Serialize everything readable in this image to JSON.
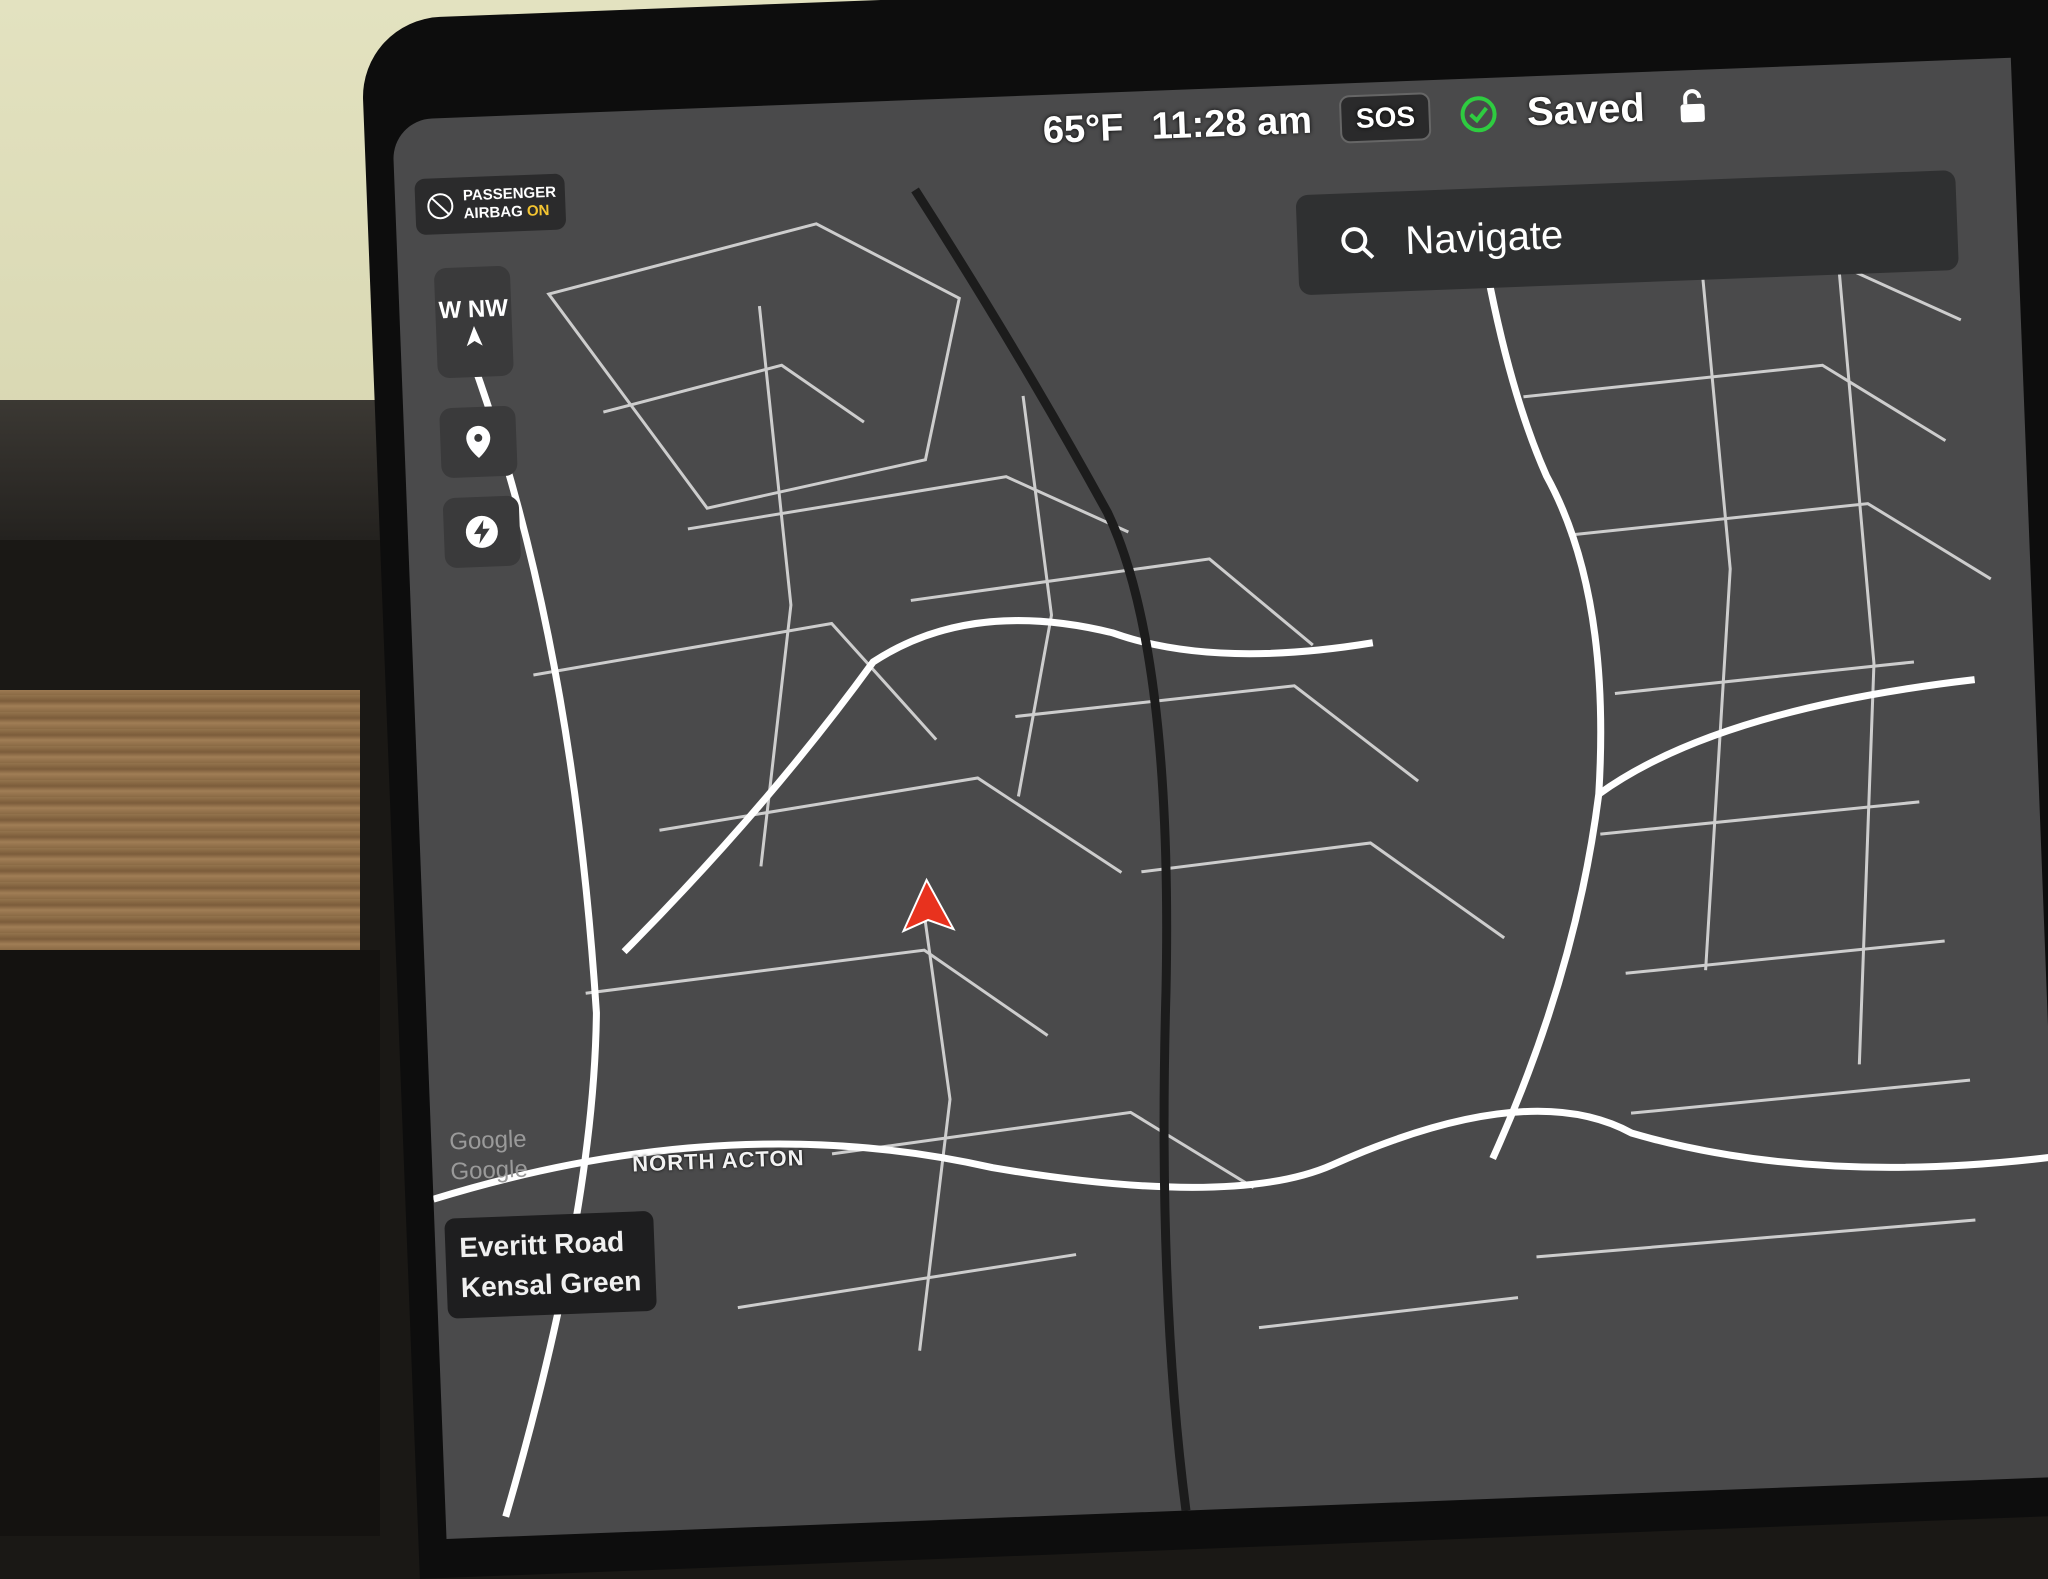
{
  "status_bar": {
    "temperature": "65°F",
    "time": "11:28 am",
    "sos_label": "SOS",
    "saved_label": "Saved"
  },
  "navigate": {
    "placeholder": "Navigate"
  },
  "airbag": {
    "line1": "PASSENGER",
    "line2_prefix": "AIRBAG",
    "line2_status": "ON"
  },
  "compass": {
    "heading": "W NW"
  },
  "map": {
    "area_label": "NORTH ACTON",
    "attribution_1": "Google",
    "attribution_2": "Google"
  },
  "location": {
    "street": "Everitt Road",
    "area": "Kensal Green"
  },
  "colors": {
    "map_bg": "#4a4a4b",
    "road": "#ffffff",
    "vehicle_arrow": "#e8321e",
    "saved_check": "#2ecc40",
    "airbag_on": "#f4c531"
  },
  "icons": [
    "search-icon",
    "pin-icon",
    "charging-icon",
    "compass-arrow-icon",
    "check-circle-icon",
    "lock-icon",
    "airbag-off-icon",
    "vehicle-arrow-icon"
  ]
}
